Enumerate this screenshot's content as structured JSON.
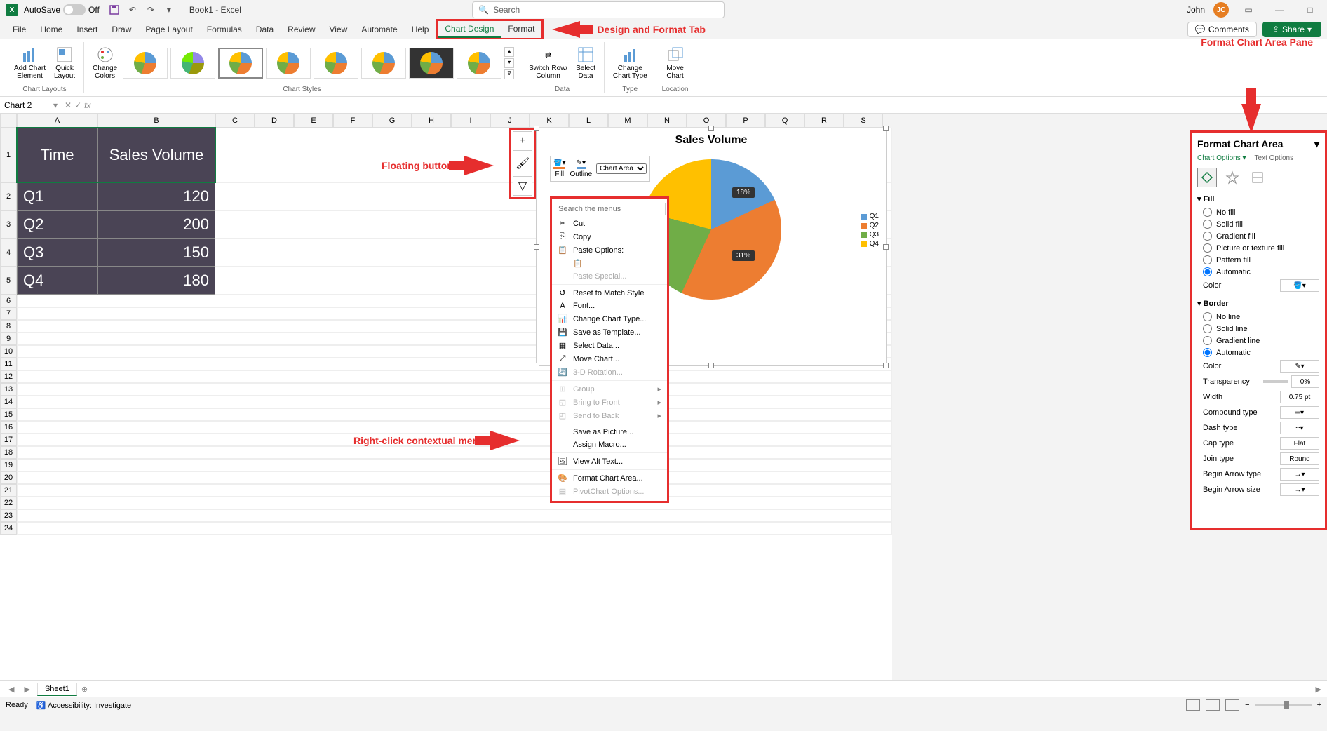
{
  "title_bar": {
    "autosave": "AutoSave",
    "autosave_state": "Off",
    "doc_name": "Book1 - Excel",
    "search_placeholder": "Search",
    "user_name": "John",
    "user_initials": "JC"
  },
  "tabs": [
    "File",
    "Home",
    "Insert",
    "Draw",
    "Page Layout",
    "Formulas",
    "Data",
    "Review",
    "View",
    "Automate",
    "Help",
    "Chart Design",
    "Format"
  ],
  "active_tab": "Chart Design",
  "comments_btn": "Comments",
  "share_btn": "Share",
  "ribbon": {
    "groups": {
      "chart_layouts": "Chart Layouts",
      "chart_styles": "Chart Styles",
      "data": "Data",
      "type": "Type",
      "location": "Location"
    },
    "buttons": {
      "add_chart_element": "Add Chart\nElement",
      "quick_layout": "Quick\nLayout",
      "change_colors": "Change\nColors",
      "switch_row_col": "Switch Row/\nColumn",
      "select_data": "Select\nData",
      "change_chart_type": "Change\nChart Type",
      "move_chart": "Move\nChart"
    }
  },
  "name_box": "Chart 2",
  "annotations": {
    "design_format": "Design and Format Tab",
    "floating_buttons": "Floating buttons",
    "context_menu": "Right-click contextual menu",
    "format_pane": "Format Chart Area Pane"
  },
  "table": {
    "headers": [
      "Time",
      "Sales Volume"
    ],
    "rows": [
      [
        "Q1",
        "120"
      ],
      [
        "Q2",
        "200"
      ],
      [
        "Q3",
        "150"
      ],
      [
        "Q4",
        "180"
      ]
    ]
  },
  "chart_data": {
    "type": "pie",
    "title": "Sales Volume",
    "categories": [
      "Q1",
      "Q2",
      "Q3",
      "Q4"
    ],
    "values": [
      120,
      200,
      150,
      180
    ],
    "data_labels": [
      "18%",
      "31%"
    ],
    "legend_position": "right",
    "colors": [
      "#5b9bd5",
      "#ed7d31",
      "#70ad47",
      "#ffc000"
    ]
  },
  "mini_toolbar": {
    "fill": "Fill",
    "outline": "Outline",
    "dropdown": "Chart Area"
  },
  "context_menu": {
    "search_placeholder": "Search the menus",
    "items": {
      "cut": "Cut",
      "copy": "Copy",
      "paste_options": "Paste Options:",
      "paste_special": "Paste Special...",
      "reset": "Reset to Match Style",
      "font": "Font...",
      "change_chart_type": "Change Chart Type...",
      "save_template": "Save as Template...",
      "select_data": "Select Data...",
      "move_chart": "Move Chart...",
      "rotation": "3-D Rotation...",
      "group": "Group",
      "bring_front": "Bring to Front",
      "send_back": "Send to Back",
      "save_picture": "Save as Picture...",
      "assign_macro": "Assign Macro...",
      "alt_text": "View Alt Text...",
      "format_chart_area": "Format Chart Area...",
      "pivot_options": "PivotChart Options..."
    }
  },
  "format_pane": {
    "title": "Format Chart Area",
    "tabs": {
      "chart_options": "Chart Options",
      "text_options": "Text Options"
    },
    "fill": {
      "header": "Fill",
      "no_fill": "No fill",
      "solid_fill": "Solid fill",
      "gradient_fill": "Gradient fill",
      "picture_fill": "Picture or texture fill",
      "pattern_fill": "Pattern fill",
      "automatic": "Automatic",
      "color_label": "Color"
    },
    "border": {
      "header": "Border",
      "no_line": "No line",
      "solid_line": "Solid line",
      "gradient_line": "Gradient line",
      "automatic": "Automatic",
      "color": "Color",
      "transparency": "Transparency",
      "transparency_val": "0%",
      "width": "Width",
      "width_val": "0.75 pt",
      "compound": "Compound type",
      "dash": "Dash type",
      "cap": "Cap type",
      "cap_val": "Flat",
      "join": "Join type",
      "join_val": "Round",
      "begin_arrow": "Begin Arrow type",
      "begin_arrow_size": "Begin Arrow size"
    }
  },
  "sheet_tab": "Sheet1",
  "status_bar": {
    "ready": "Ready",
    "accessibility": "Accessibility: Investigate"
  },
  "columns": [
    "A",
    "B",
    "C",
    "D",
    "E",
    "F",
    "G",
    "H",
    "I",
    "J",
    "K",
    "L",
    "M",
    "N",
    "O",
    "P",
    "Q",
    "R",
    "S"
  ]
}
